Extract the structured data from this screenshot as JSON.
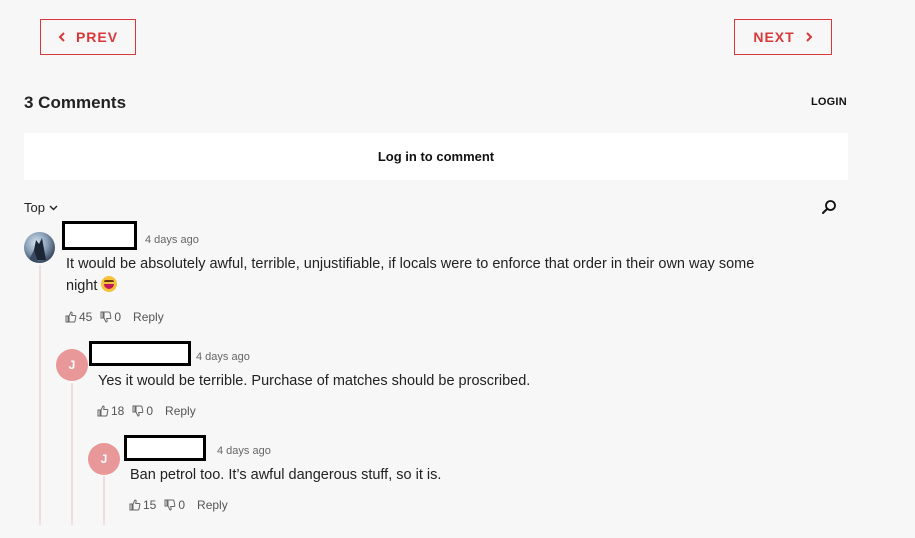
{
  "nav": {
    "prev_label": "PREV",
    "next_label": "NEXT"
  },
  "comments_header": {
    "count_label": "3 Comments",
    "login_label": "LOGIN"
  },
  "login_prompt": "Log in to comment",
  "sort": {
    "selected": "Top"
  },
  "colors": {
    "accent": "#d9383a",
    "avatar": "#e89898",
    "thread_line": "#f0dede"
  },
  "comments": [
    {
      "avatar_initial": "",
      "time": "4 days ago",
      "text_line1": "It would be absolutely awful, terrible, unjustifiable, if locals were to enforce that order in their own way some",
      "text_line2": "night",
      "emoji_icon": "laughing-face-emoji-icon",
      "likes": "45",
      "dislikes": "0",
      "reply_label": "Reply"
    },
    {
      "avatar_initial": "J",
      "time": "4 days ago",
      "text": "Yes it would be terrible. Purchase of matches should be proscribed.",
      "likes": "18",
      "dislikes": "0",
      "reply_label": "Reply"
    },
    {
      "avatar_initial": "J",
      "time": "4 days ago",
      "text": "Ban petrol too. It’s awful dangerous stuff, so it is.",
      "likes": "15",
      "dislikes": "0",
      "reply_label": "Reply"
    }
  ]
}
